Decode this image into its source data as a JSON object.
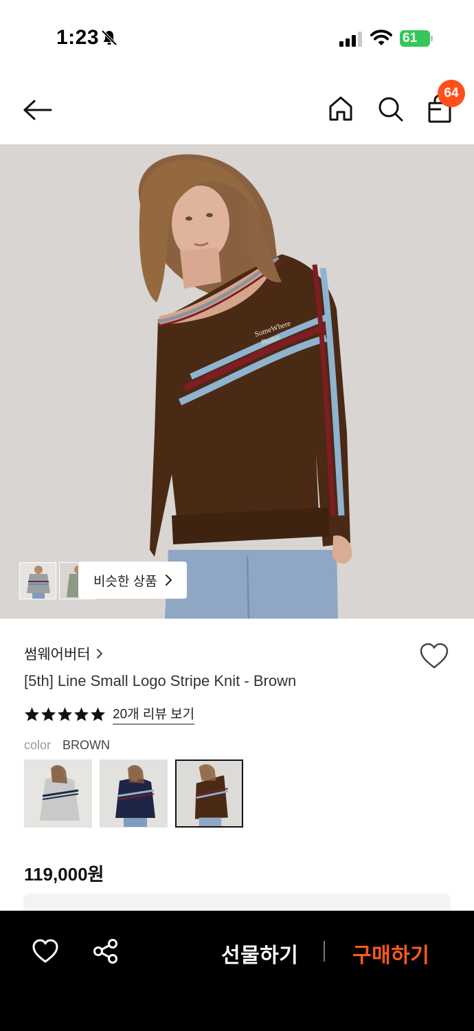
{
  "status_bar": {
    "time": "1:23",
    "battery": "61"
  },
  "header": {
    "cart_count": "64"
  },
  "hero": {
    "similar_label": "비슷한 상품"
  },
  "product": {
    "brand": "썸웨어버터",
    "title": "[5th] Line Small Logo Stripe Knit - Brown",
    "rating_stars": 5,
    "review_label": "20개 리뷰 보기",
    "color_label": "color",
    "color_value": "BROWN",
    "swatches": [
      "gray-swatch",
      "navy-swatch",
      "brown-swatch"
    ],
    "selected_swatch": 2,
    "price": "119,000원"
  },
  "bottom_bar": {
    "gift_label": "선물하기",
    "buy_label": "구매하기"
  },
  "colors": {
    "accent": "#ff4f1a",
    "buy": "#ff5a1f",
    "bottom_bar": "#000000",
    "battery": "#34c759"
  }
}
